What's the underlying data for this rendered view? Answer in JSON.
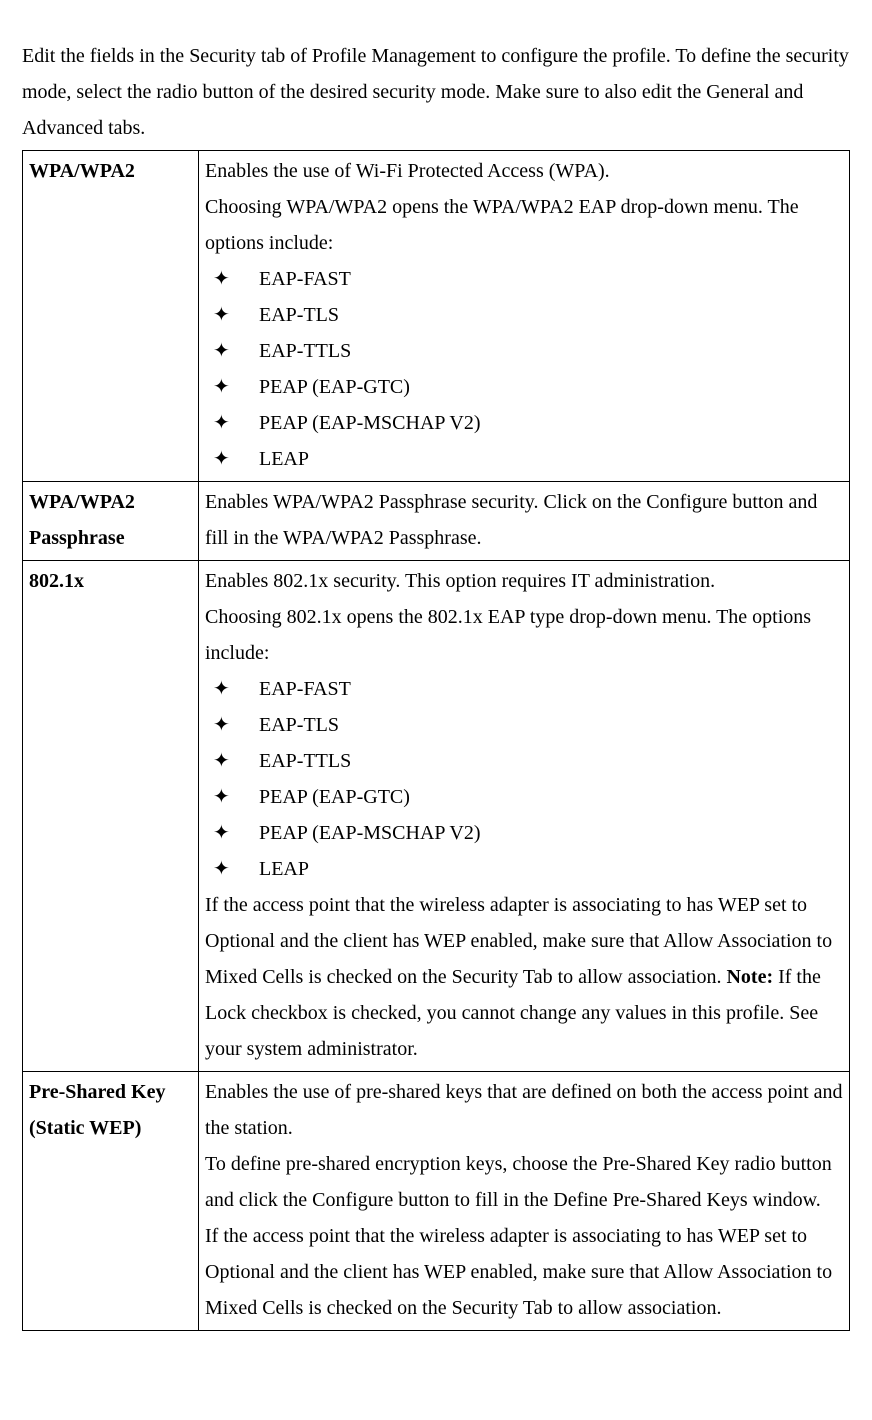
{
  "intro": "Edit the fields in the Security tab of Profile Management to configure the profile. To define the security mode, select the radio button of the desired security mode. Make sure to also edit the General and Advanced tabs.",
  "rows": {
    "wpa": {
      "term": "WPA/WPA2",
      "p1": "Enables the use of Wi-Fi Protected Access (WPA).",
      "p2": "Choosing WPA/WPA2 opens the WPA/WPA2 EAP drop-down menu. The options include:",
      "opts": [
        "EAP-FAST",
        "EAP-TLS",
        "EAP-TTLS",
        "PEAP (EAP-GTC)",
        "PEAP (EAP-MSCHAP V2)",
        "LEAP"
      ]
    },
    "passphrase": {
      "term": "WPA/WPA2 Passphrase",
      "p1": "Enables WPA/WPA2 Passphrase security. Click on the Configure button and fill in the WPA/WPA2 Passphrase."
    },
    "dot1x": {
      "term": "802.1x",
      "p1": "Enables 802.1x security. This option requires IT administration.",
      "p2": "Choosing 802.1x opens the 802.1x EAP type drop-down menu. The options include:",
      "opts": [
        "EAP-FAST",
        "EAP-TLS",
        "EAP-TTLS",
        "PEAP (EAP-GTC)",
        "PEAP (EAP-MSCHAP V2)",
        "LEAP"
      ],
      "p3a": "If the access point that the wireless adapter is associating to has WEP set to Optional and the client has WEP enabled, make sure that Allow Association to Mixed Cells is checked on the Security Tab to allow association. ",
      "noteLabel": "Note:",
      "p3b": " If the Lock checkbox is checked, you cannot change any values in this profile. See your system administrator."
    },
    "psk": {
      "term": "Pre-Shared Key (Static WEP)",
      "p1": "Enables the use of pre-shared keys that are defined on both the access point and the station.",
      "p2": "To define pre-shared encryption keys, choose the Pre-Shared Key radio button and click the Configure button to fill in the Define Pre-Shared Keys window.",
      "p3": "If the access point that the wireless adapter is associating to has WEP set to Optional and the client has WEP enabled, make sure that Allow Association to Mixed Cells is checked on the Security Tab to allow association."
    }
  }
}
